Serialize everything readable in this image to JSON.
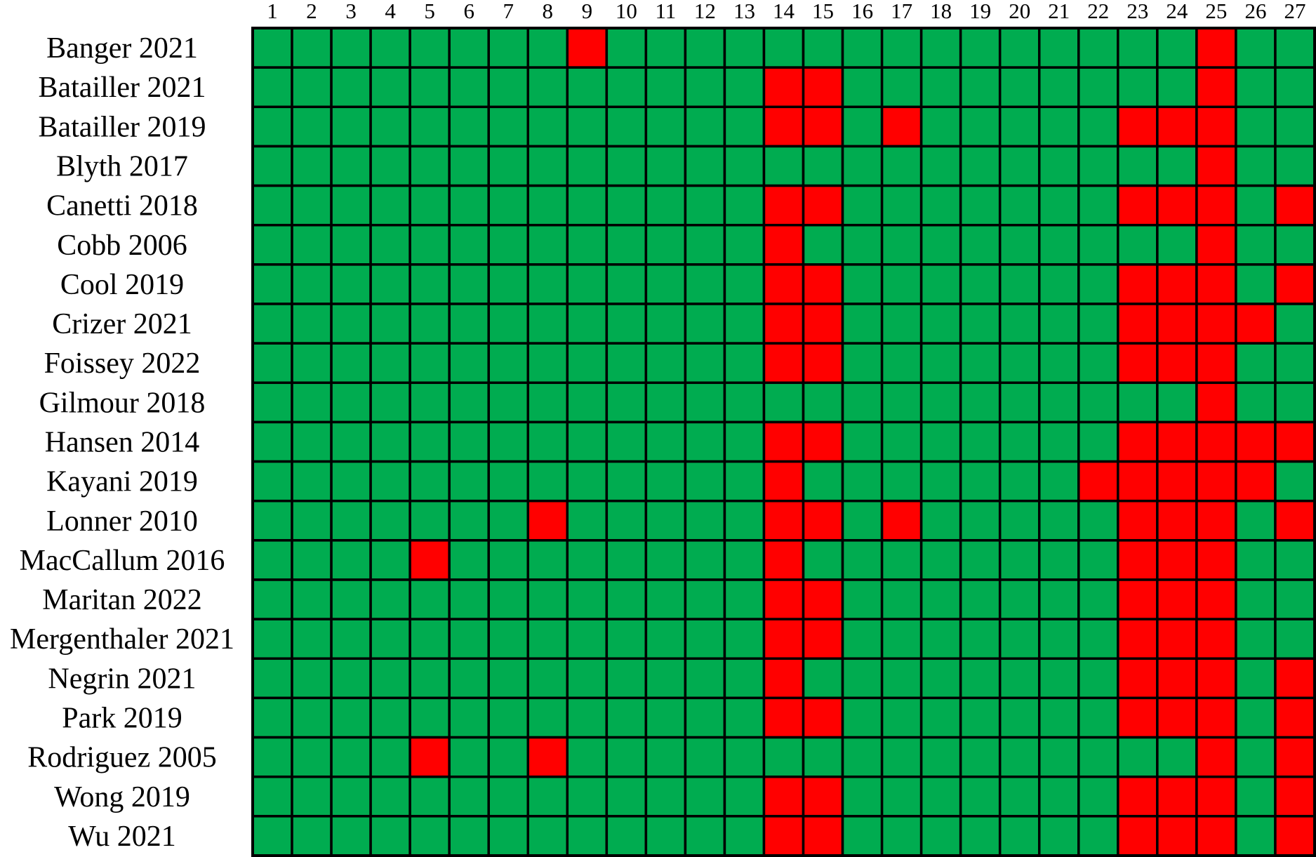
{
  "chart_data": {
    "type": "heatmap",
    "title": "",
    "xlabel": "",
    "ylabel": "",
    "legend": "none",
    "grid": true,
    "value_encoding": {
      "0": "green (criterion met / low risk)",
      "1": "red (criterion not met / high risk)"
    },
    "colors": {
      "0": "#00AC50",
      "1": "#FF0000"
    },
    "columns": [
      "1",
      "2",
      "3",
      "4",
      "5",
      "6",
      "7",
      "8",
      "9",
      "10",
      "11",
      "12",
      "13",
      "14",
      "15",
      "16",
      "17",
      "18",
      "19",
      "20",
      "21",
      "22",
      "23",
      "24",
      "25",
      "26",
      "27"
    ],
    "rows": [
      "Banger 2021",
      "Batailler 2021",
      "Batailler 2019",
      "Blyth 2017",
      "Canetti 2018",
      "Cobb 2006",
      "Cool 2019",
      "Crizer 2021",
      "Foissey 2022",
      "Gilmour 2018",
      "Hansen 2014",
      "Kayani 2019",
      "Lonner 2010",
      "MacCallum 2016",
      "Maritan 2022",
      "Mergenthaler 2021",
      "Negrin 2021",
      "Park 2019",
      "Rodriguez 2005",
      "Wong 2019",
      "Wu 2021"
    ],
    "values": [
      [
        0,
        0,
        0,
        0,
        0,
        0,
        0,
        0,
        1,
        0,
        0,
        0,
        0,
        0,
        0,
        0,
        0,
        0,
        0,
        0,
        0,
        0,
        0,
        0,
        1,
        0,
        0
      ],
      [
        0,
        0,
        0,
        0,
        0,
        0,
        0,
        0,
        0,
        0,
        0,
        0,
        0,
        1,
        1,
        0,
        0,
        0,
        0,
        0,
        0,
        0,
        0,
        0,
        1,
        0,
        0
      ],
      [
        0,
        0,
        0,
        0,
        0,
        0,
        0,
        0,
        0,
        0,
        0,
        0,
        0,
        1,
        1,
        0,
        1,
        0,
        0,
        0,
        0,
        0,
        1,
        1,
        1,
        0,
        0
      ],
      [
        0,
        0,
        0,
        0,
        0,
        0,
        0,
        0,
        0,
        0,
        0,
        0,
        0,
        0,
        0,
        0,
        0,
        0,
        0,
        0,
        0,
        0,
        0,
        0,
        1,
        0,
        0
      ],
      [
        0,
        0,
        0,
        0,
        0,
        0,
        0,
        0,
        0,
        0,
        0,
        0,
        0,
        1,
        1,
        0,
        0,
        0,
        0,
        0,
        0,
        0,
        1,
        1,
        1,
        0,
        1
      ],
      [
        0,
        0,
        0,
        0,
        0,
        0,
        0,
        0,
        0,
        0,
        0,
        0,
        0,
        1,
        0,
        0,
        0,
        0,
        0,
        0,
        0,
        0,
        0,
        0,
        1,
        0,
        0
      ],
      [
        0,
        0,
        0,
        0,
        0,
        0,
        0,
        0,
        0,
        0,
        0,
        0,
        0,
        1,
        1,
        0,
        0,
        0,
        0,
        0,
        0,
        0,
        1,
        1,
        1,
        0,
        1
      ],
      [
        0,
        0,
        0,
        0,
        0,
        0,
        0,
        0,
        0,
        0,
        0,
        0,
        0,
        1,
        1,
        0,
        0,
        0,
        0,
        0,
        0,
        0,
        1,
        1,
        1,
        1,
        0
      ],
      [
        0,
        0,
        0,
        0,
        0,
        0,
        0,
        0,
        0,
        0,
        0,
        0,
        0,
        1,
        1,
        0,
        0,
        0,
        0,
        0,
        0,
        0,
        1,
        1,
        1,
        0,
        0
      ],
      [
        0,
        0,
        0,
        0,
        0,
        0,
        0,
        0,
        0,
        0,
        0,
        0,
        0,
        0,
        0,
        0,
        0,
        0,
        0,
        0,
        0,
        0,
        0,
        0,
        1,
        0,
        0
      ],
      [
        0,
        0,
        0,
        0,
        0,
        0,
        0,
        0,
        0,
        0,
        0,
        0,
        0,
        1,
        1,
        0,
        0,
        0,
        0,
        0,
        0,
        0,
        1,
        1,
        1,
        1,
        1
      ],
      [
        0,
        0,
        0,
        0,
        0,
        0,
        0,
        0,
        0,
        0,
        0,
        0,
        0,
        1,
        0,
        0,
        0,
        0,
        0,
        0,
        0,
        1,
        1,
        1,
        1,
        1,
        0
      ],
      [
        0,
        0,
        0,
        0,
        0,
        0,
        0,
        1,
        0,
        0,
        0,
        0,
        0,
        1,
        1,
        0,
        1,
        0,
        0,
        0,
        0,
        0,
        1,
        1,
        1,
        0,
        1
      ],
      [
        0,
        0,
        0,
        0,
        1,
        0,
        0,
        0,
        0,
        0,
        0,
        0,
        0,
        1,
        0,
        0,
        0,
        0,
        0,
        0,
        0,
        0,
        1,
        1,
        1,
        0,
        0
      ],
      [
        0,
        0,
        0,
        0,
        0,
        0,
        0,
        0,
        0,
        0,
        0,
        0,
        0,
        1,
        1,
        0,
        0,
        0,
        0,
        0,
        0,
        0,
        1,
        1,
        1,
        0,
        0
      ],
      [
        0,
        0,
        0,
        0,
        0,
        0,
        0,
        0,
        0,
        0,
        0,
        0,
        0,
        1,
        1,
        0,
        0,
        0,
        0,
        0,
        0,
        0,
        1,
        1,
        1,
        0,
        0
      ],
      [
        0,
        0,
        0,
        0,
        0,
        0,
        0,
        0,
        0,
        0,
        0,
        0,
        0,
        1,
        0,
        0,
        0,
        0,
        0,
        0,
        0,
        0,
        1,
        1,
        1,
        0,
        1
      ],
      [
        0,
        0,
        0,
        0,
        0,
        0,
        0,
        0,
        0,
        0,
        0,
        0,
        0,
        1,
        1,
        0,
        0,
        0,
        0,
        0,
        0,
        0,
        1,
        1,
        1,
        0,
        1
      ],
      [
        0,
        0,
        0,
        0,
        1,
        0,
        0,
        1,
        0,
        0,
        0,
        0,
        0,
        0,
        0,
        0,
        0,
        0,
        0,
        0,
        0,
        0,
        0,
        0,
        1,
        0,
        1
      ],
      [
        0,
        0,
        0,
        0,
        0,
        0,
        0,
        0,
        0,
        0,
        0,
        0,
        0,
        1,
        1,
        0,
        0,
        0,
        0,
        0,
        0,
        0,
        1,
        1,
        1,
        0,
        1
      ],
      [
        0,
        0,
        0,
        0,
        0,
        0,
        0,
        0,
        0,
        0,
        0,
        0,
        0,
        1,
        1,
        0,
        0,
        0,
        0,
        0,
        0,
        0,
        1,
        1,
        1,
        0,
        1
      ]
    ]
  }
}
